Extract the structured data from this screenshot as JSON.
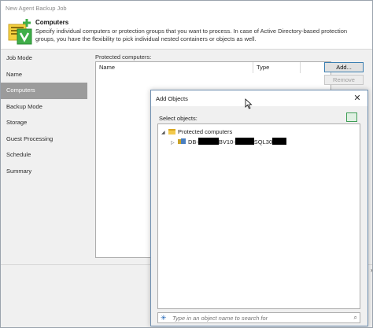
{
  "window": {
    "title": "New Agent Backup Job"
  },
  "header": {
    "title": "Computers",
    "description": "Specify individual computers or protection groups that you want to process. In case of Active Directory-based protection groups, you have the flexibility to pick individual nested containers or objects as well.",
    "logo_icon": "computers-add-icon"
  },
  "sidebar": {
    "items": [
      {
        "label": "Job Mode",
        "active": false
      },
      {
        "label": "Name",
        "active": false
      },
      {
        "label": "Computers",
        "active": true
      },
      {
        "label": "Backup Mode",
        "active": false
      },
      {
        "label": "Storage",
        "active": false
      },
      {
        "label": "Guest Processing",
        "active": false
      },
      {
        "label": "Schedule",
        "active": false
      },
      {
        "label": "Summary",
        "active": false
      }
    ]
  },
  "protected_computers": {
    "label": "Protected computers:",
    "columns": [
      "Name",
      "Type"
    ],
    "buttons": {
      "add": "Add...",
      "remove": "Remove"
    }
  },
  "add_objects_dialog": {
    "title": "Add Objects",
    "select_label": "Select objects:",
    "tree": {
      "root": {
        "label": "Protected computers",
        "expanded": true
      },
      "child": {
        "label_parts": [
          "DB-",
          "BV10-",
          "SQL30"
        ],
        "expanded": false
      }
    },
    "search": {
      "placeholder": "Type in an object name to search for"
    }
  },
  "colors": {
    "sidebar_active": "#9b9b9b",
    "accent_border": "#3c7fb1",
    "folder": "#f2c94c",
    "logo_green": "#3fae49"
  }
}
